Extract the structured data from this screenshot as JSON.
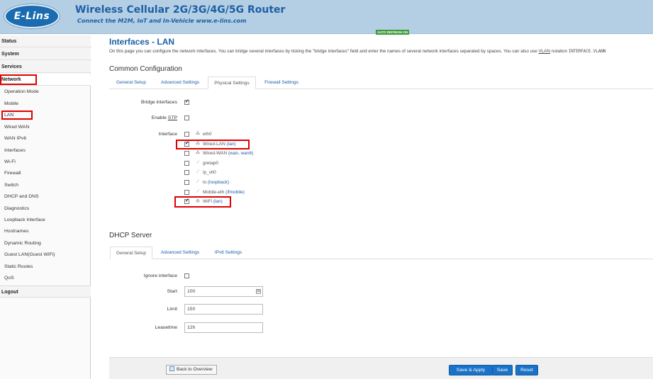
{
  "header": {
    "logo_text": "E-Lins",
    "title": "Wireless Cellular 2G/3G/4G/5G Router",
    "subtitle": "Connect the M2M, IoT and In-Vehicle www.e-lins.com",
    "auto_refresh": "AUTO REFRESH ON",
    "brand_color": "#1c5fa6"
  },
  "sidebar": {
    "categories": {
      "status": "Status",
      "system": "System",
      "services": "Services",
      "network": "Network",
      "logout": "Logout"
    },
    "network_items": [
      "Operation Mode",
      "Mobile",
      "LAN",
      "Wired WAN",
      "WAN IPv6",
      "Interfaces",
      "Wi-Fi",
      "Firewall",
      "Switch",
      "DHCP and DNS",
      "Diagnostics",
      "Loopback Interface",
      "Hostnames",
      "Dynamic Routing",
      "Guest LAN(Guest WiFi)",
      "Static Routes",
      "QoS"
    ],
    "selected_item": "LAN"
  },
  "page": {
    "title": "Interfaces - LAN",
    "description_pre": "On this page you can configure the network interfaces. You can bridge several interfaces by ticking the \"bridge interfaces\" field and enter the names of several network interfaces separated by spaces. You can also use ",
    "description_vlan": "VLAN",
    "description_mid": " notation ",
    "description_code": "INTERFACE.VLANN"
  },
  "common": {
    "title": "Common Configuration",
    "tabs": [
      "General Setup",
      "Advanced Settings",
      "Physical Settings",
      "Firewall Settings"
    ],
    "active_tab": "Physical Settings",
    "bridge_label": "Bridge interfaces",
    "bridge_checked": true,
    "stp_label_pre": "Enable ",
    "stp_label_u": "STP",
    "stp_checked": false,
    "interface_label": "Interface",
    "interfaces": [
      {
        "name": "eth0",
        "net": "",
        "checked": false,
        "icon": "ethernet-port-icon"
      },
      {
        "name": "Wired-LAN ",
        "net": "(lan)",
        "checked": true,
        "icon": "ethernet-switch-icon"
      },
      {
        "name": "Wired-WAN ",
        "net": "(wan, wan6)",
        "checked": false,
        "icon": "ethernet-switch-icon"
      },
      {
        "name": "gretap0",
        "net": "",
        "checked": false,
        "icon": "tunnel-icon"
      },
      {
        "name": "ip_vti0",
        "net": "",
        "checked": false,
        "icon": "tunnel-icon"
      },
      {
        "name": "lo ",
        "net": "(loopback)",
        "checked": false,
        "icon": "tunnel-icon"
      },
      {
        "name": "Mobile-eth ",
        "net": "(ifmobile)",
        "checked": false,
        "icon": "tunnel-icon"
      },
      {
        "name": "WiFi ",
        "net": "(lan)",
        "checked": true,
        "icon": "wifi-icon"
      }
    ]
  },
  "dhcp": {
    "title": "DHCP Server",
    "tabs": [
      "General Setup",
      "Advanced Settings",
      "IPv6 Settings"
    ],
    "active_tab": "General Setup",
    "ignore_label": "Ignore interface",
    "ignore_checked": false,
    "start_label": "Start",
    "start_value": "100",
    "limit_label": "Limit",
    "limit_value": "150",
    "leasetime_label": "Leasetime",
    "leasetime_value": "12h"
  },
  "footer": {
    "back_label": "Back to Overview",
    "save_apply_label": "Save & Apply",
    "save_label": "Save",
    "reset_label": "Reset"
  },
  "highlight_color": "#e00000"
}
